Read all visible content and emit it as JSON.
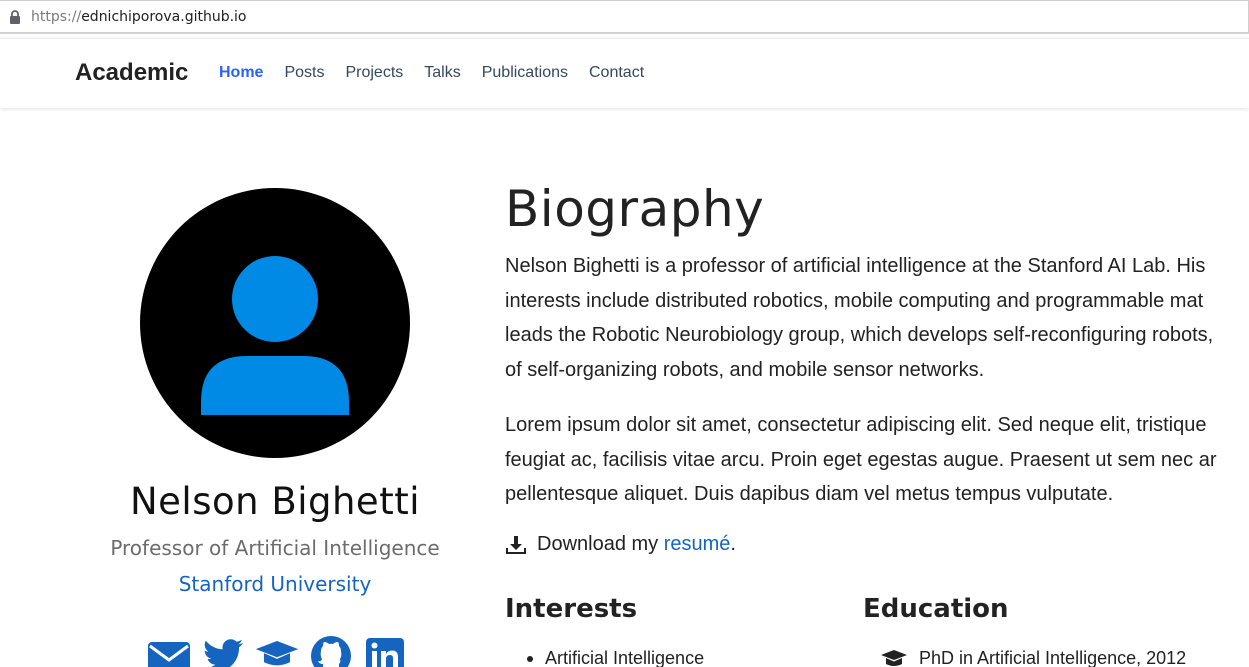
{
  "browser": {
    "url_scheme": "https://",
    "url_host": "ednichiporova.github.io"
  },
  "navbar": {
    "brand": "Academic",
    "links": [
      {
        "label": "Home",
        "active": true
      },
      {
        "label": "Posts",
        "active": false
      },
      {
        "label": "Projects",
        "active": false
      },
      {
        "label": "Talks",
        "active": false
      },
      {
        "label": "Publications",
        "active": false
      },
      {
        "label": "Contact",
        "active": false
      }
    ]
  },
  "profile": {
    "name": "Nelson Bighetti",
    "role": "Professor of Artificial Intelligence",
    "organization": "Stanford University",
    "social_icons": [
      "envelope-icon",
      "twitter-icon",
      "graduation-cap-icon",
      "github-icon",
      "linkedin-icon"
    ],
    "avatar_color": "#008ae6"
  },
  "biography": {
    "title": "Biography",
    "paragraph1_lines": [
      "Nelson Bighetti is a professor of artificial intelligence at the Stanford AI Lab. His",
      "interests include distributed robotics, mobile computing and programmable mat",
      "leads the Robotic Neurobiology group, which develops self-reconfiguring robots,",
      "of self-organizing robots, and mobile sensor networks."
    ],
    "paragraph2_lines": [
      "Lorem ipsum dolor sit amet, consectetur adipiscing elit. Sed neque elit, tristique",
      "feugiat ac, facilisis vitae arcu. Proin eget egestas augue. Praesent ut sem nec ar",
      "pellentesque aliquet. Duis dapibus diam vel metus tempus vulputate."
    ],
    "download_prefix": "Download my ",
    "download_link": "resumé",
    "download_suffix": "."
  },
  "interests": {
    "heading": "Interests",
    "items": [
      "Artificial Intelligence"
    ]
  },
  "education": {
    "heading": "Education",
    "items": [
      "PhD in Artificial Intelligence, 2012"
    ]
  },
  "colors": {
    "accent": "#2962ff",
    "link": "#1565c0"
  }
}
